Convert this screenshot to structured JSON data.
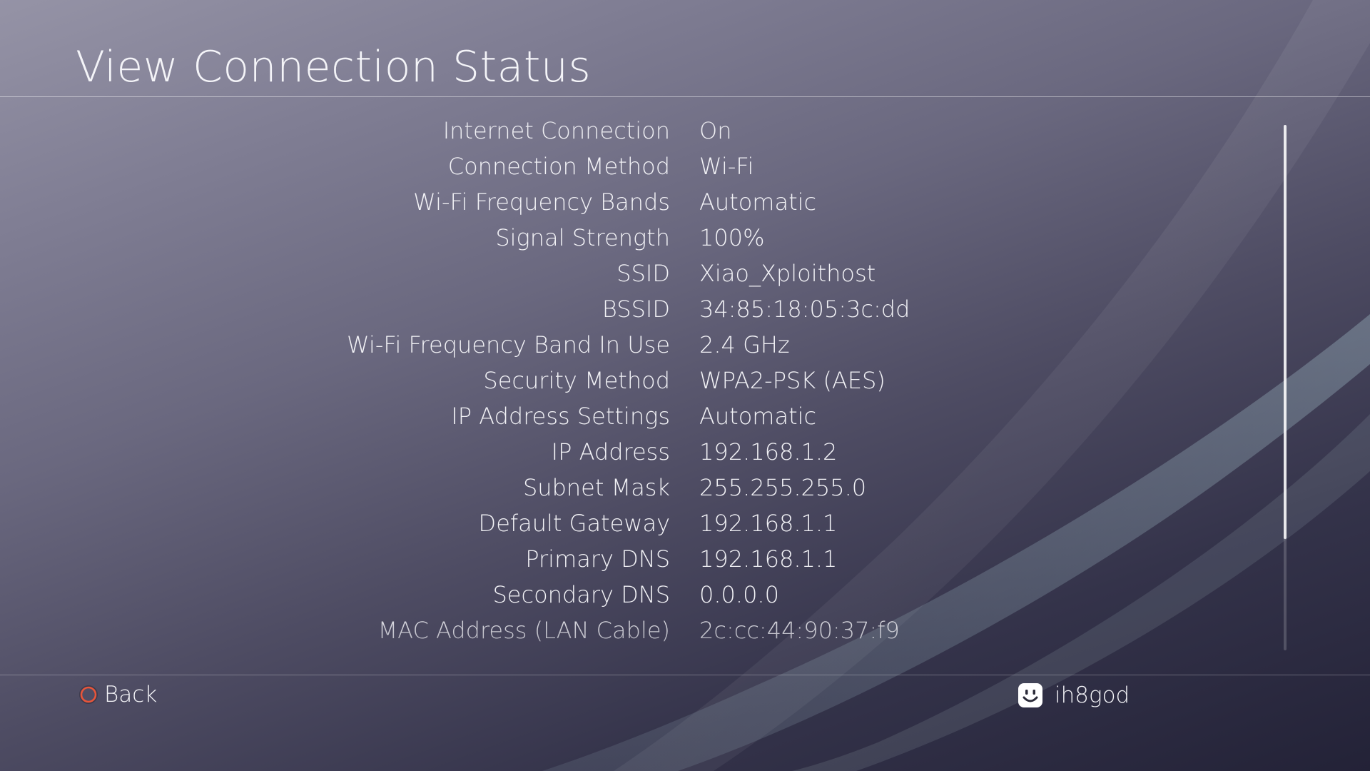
{
  "page": {
    "title": "View Connection Status"
  },
  "rows": [
    {
      "label": "Internet Connection",
      "value": "On"
    },
    {
      "label": "Connection Method",
      "value": "Wi-Fi"
    },
    {
      "label": "Wi-Fi Frequency Bands",
      "value": "Automatic"
    },
    {
      "label": "Signal Strength",
      "value": "100%"
    },
    {
      "label": "SSID",
      "value": "Xiao_Xploithost"
    },
    {
      "label": "BSSID",
      "value": "34:85:18:05:3c:dd"
    },
    {
      "label": "Wi-Fi Frequency Band In Use",
      "value": "2.4 GHz"
    },
    {
      "label": "Security Method",
      "value": "WPA2-PSK (AES)"
    },
    {
      "label": "IP Address Settings",
      "value": "Automatic"
    },
    {
      "label": "IP Address",
      "value": "192.168.1.2"
    },
    {
      "label": "Subnet Mask",
      "value": "255.255.255.0"
    },
    {
      "label": "Default Gateway",
      "value": "192.168.1.1"
    },
    {
      "label": "Primary DNS",
      "value": "192.168.1.1"
    },
    {
      "label": "Secondary DNS",
      "value": "0.0.0.0"
    },
    {
      "label": "MAC Address (LAN Cable)",
      "value": "2c:cc:44:90:37:f9"
    }
  ],
  "footer": {
    "back_label": "Back",
    "back_icon": "circle-button-icon",
    "username": "ih8god",
    "avatar_icon": "smiley-avatar-icon"
  },
  "colors": {
    "circle_button": "#e8553a",
    "text": "#f2f2f6"
  }
}
